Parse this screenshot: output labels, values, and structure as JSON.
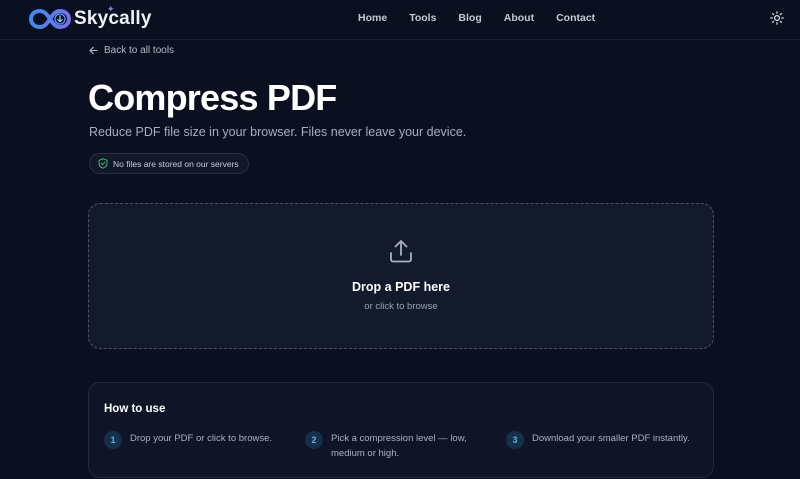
{
  "brand": {
    "name": "Skycally"
  },
  "nav": {
    "links": [
      "Home",
      "Tools",
      "Blog",
      "About",
      "Contact"
    ],
    "theme_icon": "sun-icon"
  },
  "back_link": "Back to all tools",
  "page": {
    "title": "Compress PDF",
    "subtitle": "Reduce PDF file size in your browser. Files never leave your device.",
    "badge": "No files are stored on our servers"
  },
  "dropzone": {
    "icon": "upload-icon",
    "title": "Drop a PDF here",
    "subtitle": "or click to browse"
  },
  "howto": {
    "title": "How to use",
    "steps": [
      {
        "num": "1",
        "text": "Drop your PDF or click to browse."
      },
      {
        "num": "2",
        "text": "Pick a compression level — low, medium or high."
      },
      {
        "num": "3",
        "text": "Download your smaller PDF instantly."
      }
    ]
  },
  "colors": {
    "background": "#0b1020",
    "accent": "#4fb4f0",
    "badge_check": "#3fb97a"
  }
}
